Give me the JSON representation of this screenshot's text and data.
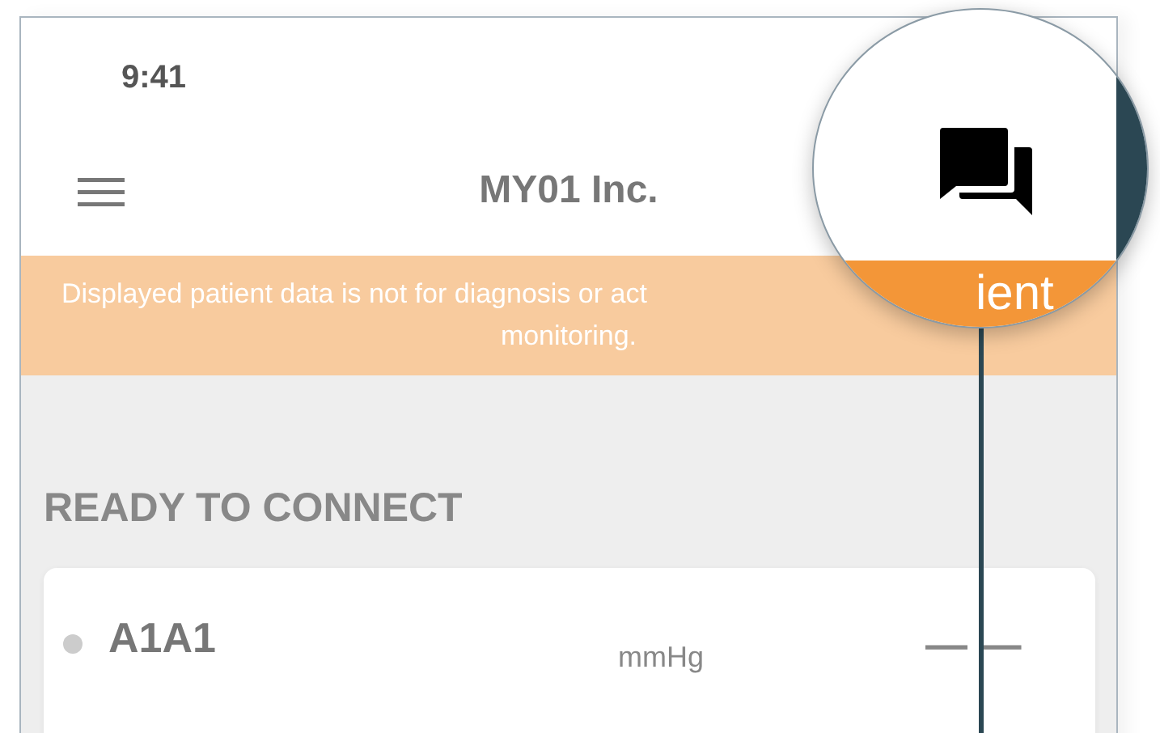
{
  "status_bar": {
    "time": "9:41"
  },
  "header": {
    "title": "MY01 Inc."
  },
  "banner": {
    "line_1": "Displayed patient data is not for diagnosis or act",
    "line_2": "monitoring."
  },
  "section": {
    "title": "READY TO CONNECT"
  },
  "devices": [
    {
      "name": "A1A1",
      "unit": "mmHg",
      "reading": "— —",
      "connected": false
    }
  ],
  "magnifier": {
    "banner_fragment": "ient"
  }
}
